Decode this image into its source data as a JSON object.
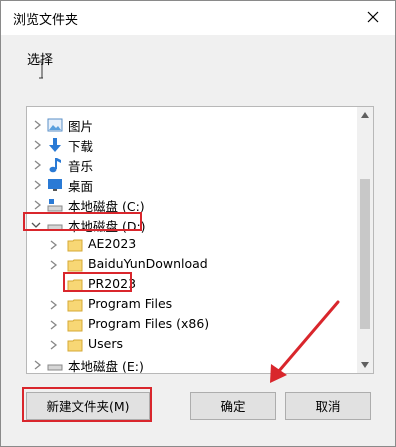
{
  "window": {
    "title": "浏览文件夹"
  },
  "instruction": "选择",
  "tree": [
    {
      "label": "图片",
      "icon": "pictures-icon"
    },
    {
      "label": "下载",
      "icon": "download-icon"
    },
    {
      "label": "音乐",
      "icon": "music-icon"
    },
    {
      "label": "桌面",
      "icon": "desktop-icon"
    },
    {
      "label": "本地磁盘 (C:)",
      "icon": "drive-c-icon"
    },
    {
      "label": "本地磁盘 (D:)",
      "icon": "drive-d-icon"
    },
    {
      "label": "AE2023",
      "icon": "folder-icon"
    },
    {
      "label": "BaiduYunDownload",
      "icon": "folder-icon"
    },
    {
      "label": "PR2023",
      "icon": "folder-icon"
    },
    {
      "label": "Program Files",
      "icon": "folder-icon"
    },
    {
      "label": "Program Files (x86)",
      "icon": "folder-icon"
    },
    {
      "label": "Users",
      "icon": "folder-icon"
    },
    {
      "label": "本地磁盘 (E:)",
      "icon": "drive-e-icon"
    }
  ],
  "buttons": {
    "new_folder": "新建文件夹(M)",
    "ok": "确定",
    "cancel": "取消"
  },
  "colors": {
    "highlight": "#d9262c",
    "folder": "#f8d775",
    "selected": "#cce8ff"
  }
}
